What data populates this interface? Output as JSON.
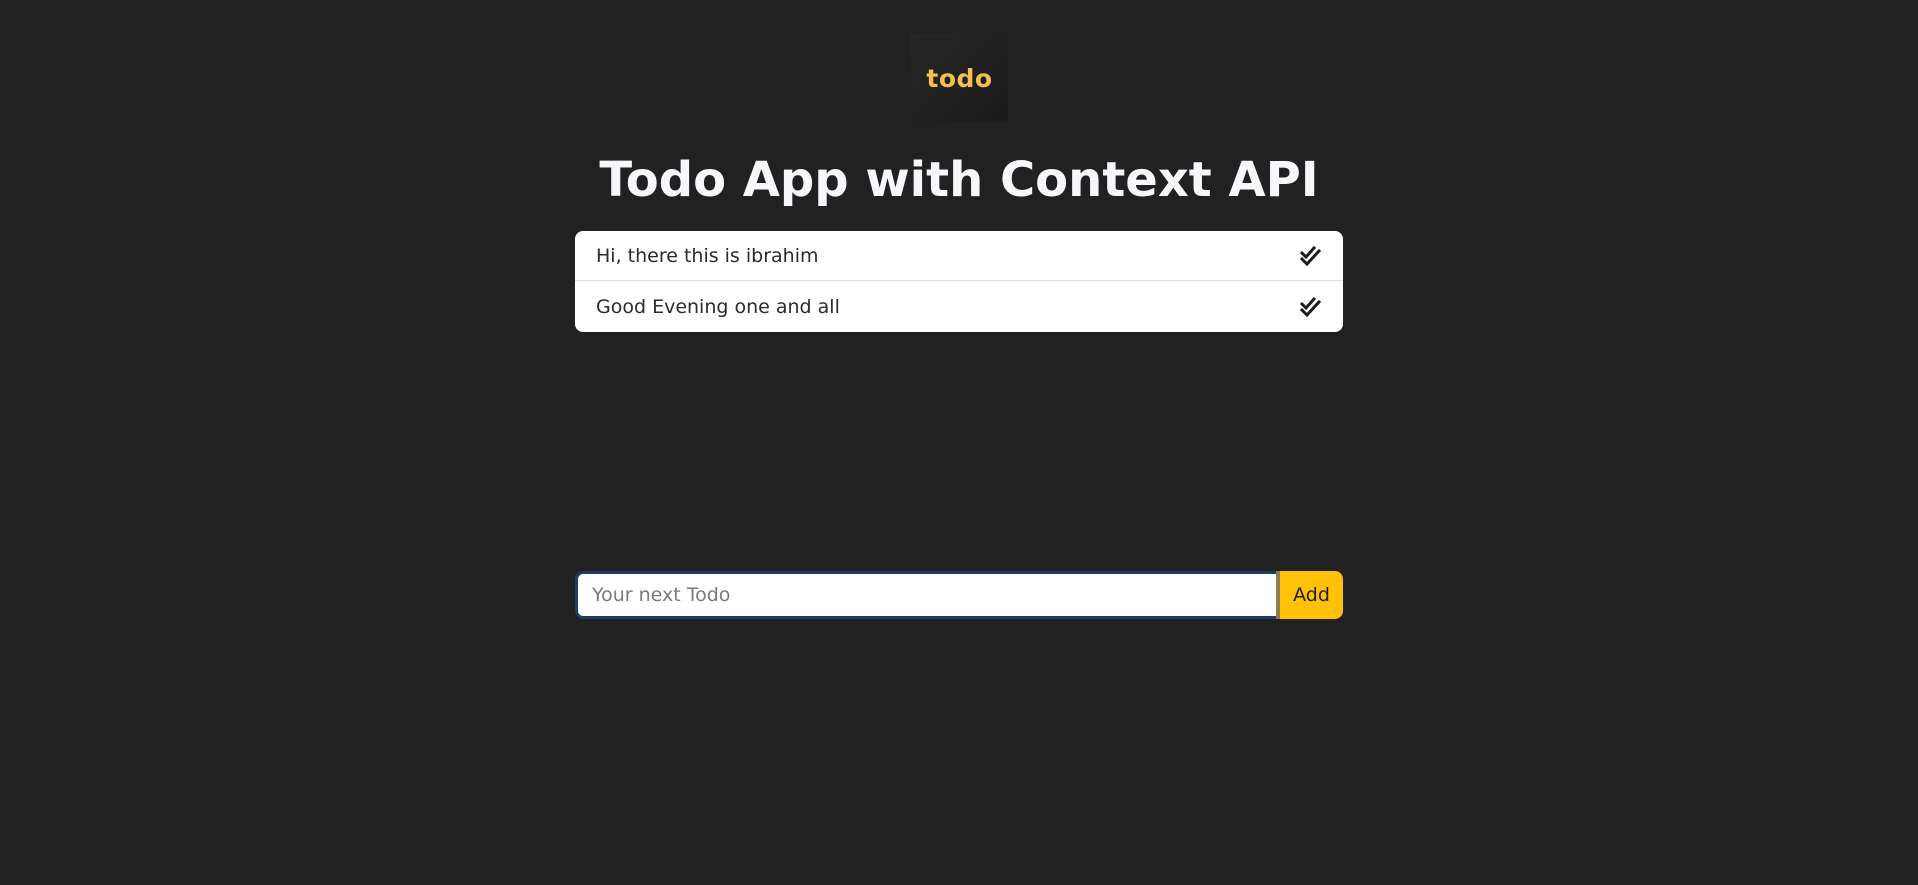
{
  "logo": {
    "text": "todo",
    "color": "#f4bf4f"
  },
  "header": {
    "title": "Todo App with Context API"
  },
  "todos": [
    {
      "text": "Hi, there this is ibrahim",
      "icon": "double-check-icon"
    },
    {
      "text": "Good Evening one and all",
      "icon": "double-check-icon"
    }
  ],
  "form": {
    "input_value": "",
    "placeholder": "Your next Todo",
    "add_label": "Add"
  },
  "colors": {
    "background": "#212121",
    "accent": "#ffc107",
    "input_focus_border": "#1f3d63"
  }
}
